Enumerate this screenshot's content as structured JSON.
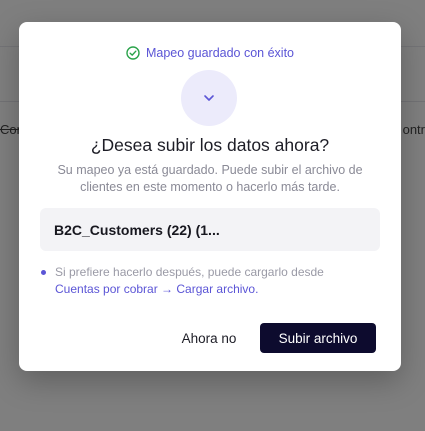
{
  "background": {
    "tab_left_label": "Cont",
    "tab_right_label": "ontr"
  },
  "modal": {
    "status_text": "Mapeo guardado con éxito",
    "status_icon": "check-circle-icon",
    "badge_icon": "chevron-down-icon",
    "title": "¿Desea subir los datos ahora?",
    "description": "Su mapeo ya está guardado. Puede subir el archivo de clientes en este momento o hacerlo más tarde.",
    "file_name": "B2C_Customers (22) (1...",
    "note_text": "Si prefiere hacerlo después, puede cargarlo desde",
    "note_link": "Cuentas por cobrar → Cargar archivo.",
    "secondary_button": "Ahora no",
    "primary_button": "Subir archivo"
  },
  "colors": {
    "accent": "#5b55d6",
    "primary_button_bg": "#0d0b2e",
    "badge_bg": "#ecebfb",
    "file_box_bg": "#f3f3f6"
  }
}
